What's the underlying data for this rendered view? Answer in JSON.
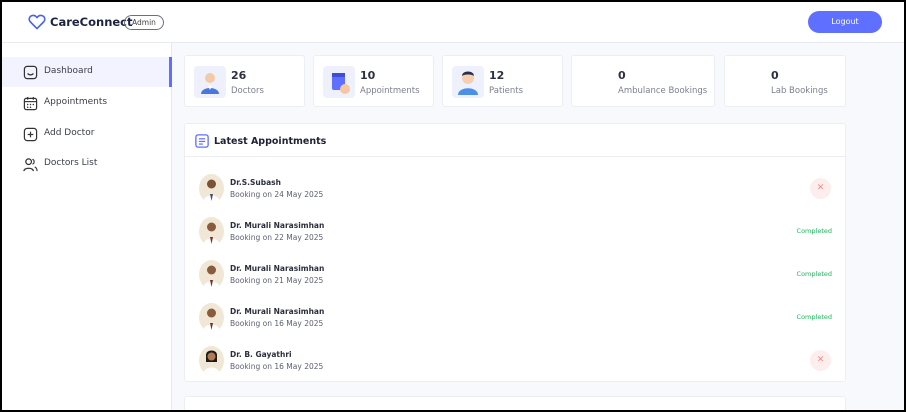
{
  "header": {
    "brand": "CareConnect",
    "role": "Admin",
    "logout_label": "Logout"
  },
  "sidebar": {
    "items": [
      {
        "label": "Dashboard",
        "icon": "home-icon",
        "active": true
      },
      {
        "label": "Appointments",
        "icon": "calendar-icon",
        "active": false
      },
      {
        "label": "Add Doctor",
        "icon": "add-icon",
        "active": false
      },
      {
        "label": "Doctors List",
        "icon": "people-icon",
        "active": false
      }
    ]
  },
  "stats": [
    {
      "value": "26",
      "label": "Doctors",
      "icon": "doctor-icon"
    },
    {
      "value": "10",
      "label": "Appointments",
      "icon": "appointments-icon"
    },
    {
      "value": "12",
      "label": "Patients",
      "icon": "patient-icon"
    },
    {
      "value": "0",
      "label": "Ambulance Bookings"
    },
    {
      "value": "0",
      "label": "Lab Bookings"
    }
  ],
  "latest": {
    "title": "Latest Appointments",
    "rows": [
      {
        "doctor": "Dr.S.Subash",
        "booking": "Booking on 24 May 2025",
        "status": "cancelled",
        "status_label": "✕"
      },
      {
        "doctor": "Dr. Murali Narasimhan",
        "booking": "Booking on 22 May 2025",
        "status": "completed",
        "status_label": "Completed"
      },
      {
        "doctor": "Dr. Murali Narasimhan",
        "booking": "Booking on 21 May 2025",
        "status": "completed",
        "status_label": "Completed"
      },
      {
        "doctor": "Dr. Murali Narasimhan",
        "booking": "Booking on 16 May 2025",
        "status": "completed",
        "status_label": "Completed"
      },
      {
        "doctor": "Dr. B. Gayathri",
        "booking": "Booking on 16 May 2025",
        "status": "cancelled",
        "status_label": "✕"
      }
    ]
  },
  "colors": {
    "accent": "#5f6fff",
    "completed": "#22b35f",
    "cancel": "#f08a8a"
  }
}
